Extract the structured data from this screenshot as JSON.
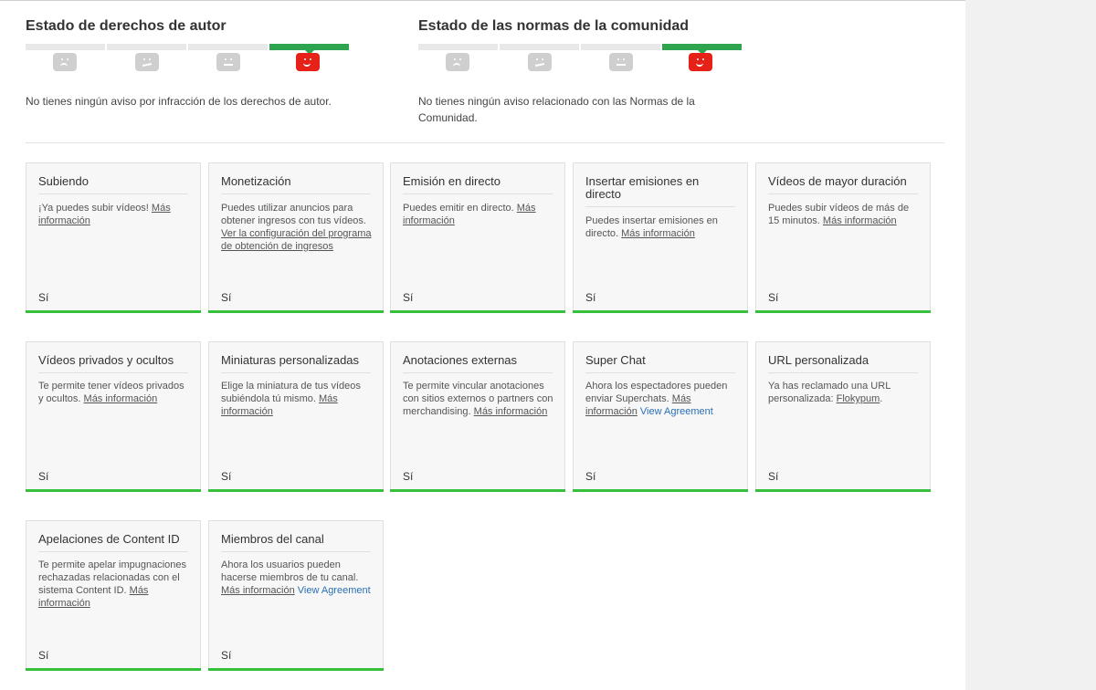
{
  "copyright": {
    "title": "Estado de derechos de autor",
    "description": "No tienes ningún aviso por infracción de los derechos de autor."
  },
  "community": {
    "title": "Estado de las normas de la comunidad",
    "description": "No tienes ningún aviso relacionado con las Normas de la Comunidad."
  },
  "colors": {
    "active": "#2ea44f",
    "red_face": "#e62117",
    "card_bar": "#35c13b",
    "agreement_link": "#2a6fb5"
  },
  "features": [
    {
      "title": "Subiendo",
      "text": "¡Ya puedes subir vídeos! ",
      "link": "Más información",
      "value": "Sí"
    },
    {
      "title": "Monetización",
      "text": "Puedes utilizar anuncios para obtener ingresos con tus vídeos. ",
      "link": "Ver la configuración del programa de obtención de ingresos",
      "value": "Sí"
    },
    {
      "title": "Emisión en directo",
      "text": "Puedes emitir en directo. ",
      "link": "Más información",
      "value": "Sí"
    },
    {
      "title": "Insertar emisiones en directo",
      "text": "Puedes insertar emisiones en directo. ",
      "link": "Más información",
      "value": "Sí"
    },
    {
      "title": "Vídeos de mayor duración",
      "text": "Puedes subir vídeos de más de 15 minutos. ",
      "link": "Más información",
      "value": "Sí"
    },
    {
      "title": "Vídeos privados y ocultos",
      "text": "Te permite tener vídeos privados y ocultos. ",
      "link": "Más información",
      "value": "Sí"
    },
    {
      "title": "Miniaturas personalizadas",
      "text": "Elige la miniatura de tus vídeos subiéndola tú mismo. ",
      "link": "Más información",
      "value": "Sí"
    },
    {
      "title": "Anotaciones externas",
      "text": "Te permite vincular anotaciones con sitios externos o partners con merchandising. ",
      "link": "Más información",
      "value": "Sí"
    },
    {
      "title": "Super Chat",
      "text": "Ahora los espectadores pueden enviar Superchats. ",
      "link": "Más información",
      "extra": " View Agreement",
      "value": "Sí"
    },
    {
      "title": "URL personalizada",
      "text": "Ya has reclamado una URL personalizada: ",
      "link": "Flokypum",
      "suffix": ".",
      "value": "Sí"
    },
    {
      "title": "Apelaciones de Content ID",
      "text": "Te permite apelar impugnaciones rechazadas relacionadas con el sistema Content ID. ",
      "link": "Más información",
      "value": "Sí"
    },
    {
      "title": "Miembros del canal",
      "text": "Ahora los usuarios pueden hacerse miembros de tu canal. ",
      "link": "Más información",
      "extra": " View Agreement",
      "value": "Sí"
    }
  ]
}
